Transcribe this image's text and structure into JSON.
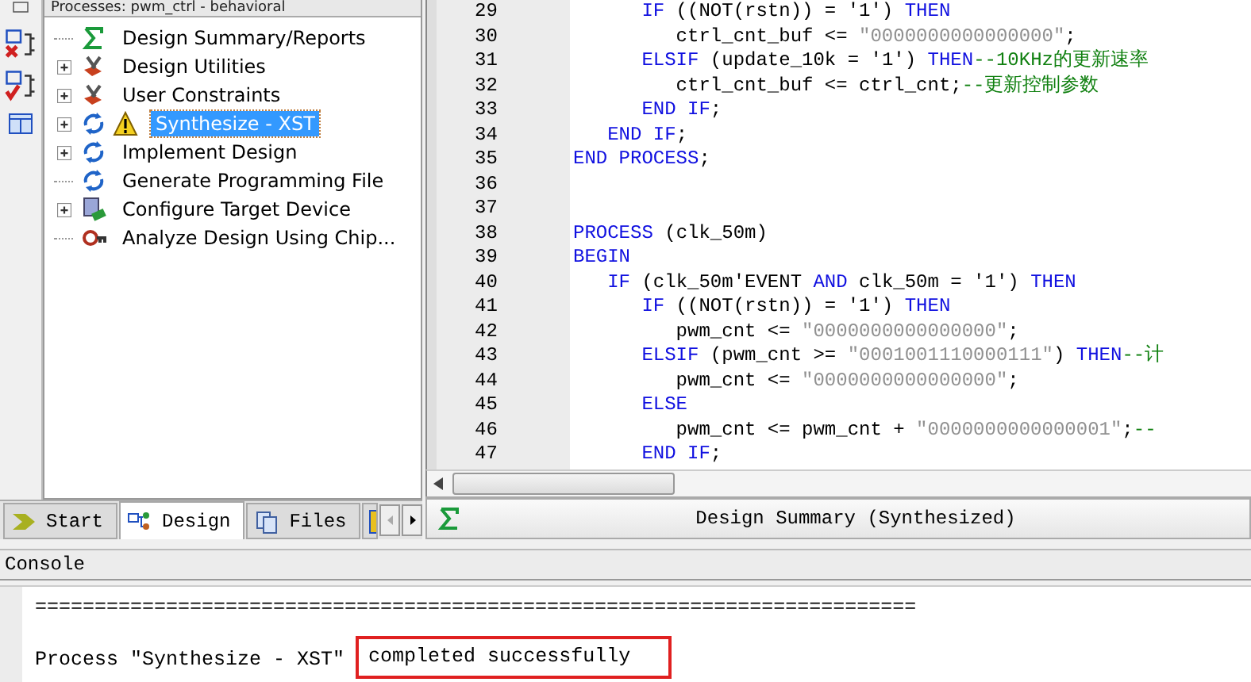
{
  "processes_panel": {
    "title": "Processes: pwm_ctrl - behavioral",
    "items": [
      {
        "label": "Design Summary/Reports",
        "kind": "sigma",
        "expandable": false,
        "selected": false
      },
      {
        "label": "Design Utilities",
        "kind": "tools",
        "expandable": true,
        "selected": false
      },
      {
        "label": "User Constraints",
        "kind": "tools",
        "expandable": true,
        "selected": false
      },
      {
        "label": "Synthesize - XST",
        "kind": "refresh",
        "expandable": true,
        "warning": true,
        "selected": true
      },
      {
        "label": "Implement Design",
        "kind": "refresh",
        "expandable": true,
        "selected": false
      },
      {
        "label": "Generate Programming File",
        "kind": "refresh",
        "expandable": false,
        "selected": false
      },
      {
        "label": "Configure Target Device",
        "kind": "device",
        "expandable": true,
        "selected": false
      },
      {
        "label": "Analyze Design Using Chip...",
        "kind": "probe",
        "expandable": false,
        "selected": false
      }
    ]
  },
  "left_tabs": [
    {
      "label": "Start",
      "kind": "arrow",
      "selected": false
    },
    {
      "label": "Design",
      "kind": "hierarchy",
      "selected": true
    },
    {
      "label": "Files",
      "kind": "files",
      "selected": false
    },
    {
      "kind": "library",
      "selected": false
    }
  ],
  "editor": {
    "lines": [
      {
        "number": "29",
        "segments": [
          {
            "kind": "keyword",
            "text": "      IF"
          },
          {
            "kind": "text",
            "text": " ((NOT(rstn)) = '1') "
          },
          {
            "kind": "keyword",
            "text": "THEN"
          }
        ]
      },
      {
        "number": "30",
        "segments": [
          {
            "kind": "text",
            "text": "         ctrl_cnt_buf <= "
          },
          {
            "kind": "string",
            "text": "\"0000000000000000\""
          },
          {
            "kind": "text",
            "text": ";"
          }
        ]
      },
      {
        "number": "31",
        "segments": [
          {
            "kind": "keyword",
            "text": "      ELSIF"
          },
          {
            "kind": "text",
            "text": " (update_10k = '1') "
          },
          {
            "kind": "keyword",
            "text": "THEN"
          },
          {
            "kind": "comment",
            "text": "--10KHz的更新速率"
          }
        ]
      },
      {
        "number": "32",
        "segments": [
          {
            "kind": "text",
            "text": "         ctrl_cnt_buf <= ctrl_cnt;"
          },
          {
            "kind": "comment",
            "text": "--更新控制参数"
          }
        ]
      },
      {
        "number": "33",
        "segments": [
          {
            "kind": "keyword",
            "text": "      END IF"
          },
          {
            "kind": "text",
            "text": ";"
          }
        ]
      },
      {
        "number": "34",
        "segments": [
          {
            "kind": "keyword",
            "text": "   END IF"
          },
          {
            "kind": "text",
            "text": ";"
          }
        ]
      },
      {
        "number": "35",
        "segments": [
          {
            "kind": "keyword",
            "text": "END PROCESS"
          },
          {
            "kind": "text",
            "text": ";"
          }
        ]
      },
      {
        "number": "36"
      },
      {
        "number": "37"
      },
      {
        "number": "38",
        "segments": [
          {
            "kind": "keyword",
            "text": "PROCESS"
          },
          {
            "kind": "text",
            "text": " (clk_50m)"
          }
        ]
      },
      {
        "number": "39",
        "segments": [
          {
            "kind": "keyword",
            "text": "BEGIN"
          }
        ]
      },
      {
        "number": "40",
        "segments": [
          {
            "kind": "keyword",
            "text": "   IF"
          },
          {
            "kind": "text",
            "text": " (clk_50m'EVENT "
          },
          {
            "kind": "keyword",
            "text": "AND"
          },
          {
            "kind": "text",
            "text": " clk_50m = '1') "
          },
          {
            "kind": "keyword",
            "text": "THEN"
          }
        ]
      },
      {
        "number": "41",
        "segments": [
          {
            "kind": "keyword",
            "text": "      IF"
          },
          {
            "kind": "text",
            "text": " ((NOT(rstn)) = '1') "
          },
          {
            "kind": "keyword",
            "text": "THEN"
          }
        ]
      },
      {
        "number": "42",
        "segments": [
          {
            "kind": "text",
            "text": "         pwm_cnt <= "
          },
          {
            "kind": "string",
            "text": "\"0000000000000000\""
          },
          {
            "kind": "text",
            "text": ";"
          }
        ]
      },
      {
        "number": "43",
        "segments": [
          {
            "kind": "keyword",
            "text": "      ELSIF"
          },
          {
            "kind": "text",
            "text": " (pwm_cnt >= "
          },
          {
            "kind": "string",
            "text": "\"0001001110000111\""
          },
          {
            "kind": "text",
            "text": ") "
          },
          {
            "kind": "keyword",
            "text": "THEN"
          },
          {
            "kind": "comment",
            "text": "--计"
          }
        ]
      },
      {
        "number": "44",
        "segments": [
          {
            "kind": "text",
            "text": "         pwm_cnt <= "
          },
          {
            "kind": "string",
            "text": "\"0000000000000000\""
          },
          {
            "kind": "text",
            "text": ";"
          }
        ]
      },
      {
        "number": "45",
        "segments": [
          {
            "kind": "keyword",
            "text": "      ELSE"
          }
        ]
      },
      {
        "number": "46",
        "segments": [
          {
            "kind": "text",
            "text": "         pwm_cnt <= pwm_cnt + "
          },
          {
            "kind": "string",
            "text": "\"0000000000000001\""
          },
          {
            "kind": "text",
            "text": ";"
          },
          {
            "kind": "comment",
            "text": "--"
          }
        ]
      },
      {
        "number": "47",
        "segments": [
          {
            "kind": "keyword",
            "text": "      END IF"
          },
          {
            "kind": "text",
            "text": ";"
          }
        ]
      }
    ]
  },
  "right_tabs": [
    {
      "label": "Design Summary (Synthesized)",
      "kind": "sigma",
      "selected": true
    }
  ],
  "console": {
    "title": "Console",
    "lines": [
      {
        "segments": [
          {
            "text": "==========================================================================",
            "highlighted": false
          }
        ]
      },
      {
        "segments": [
          {
            "text": "Process \"Synthesize - XST\"",
            "highlighted": false
          },
          {
            "text": "completed successfully",
            "highlighted": true
          }
        ]
      }
    ]
  }
}
